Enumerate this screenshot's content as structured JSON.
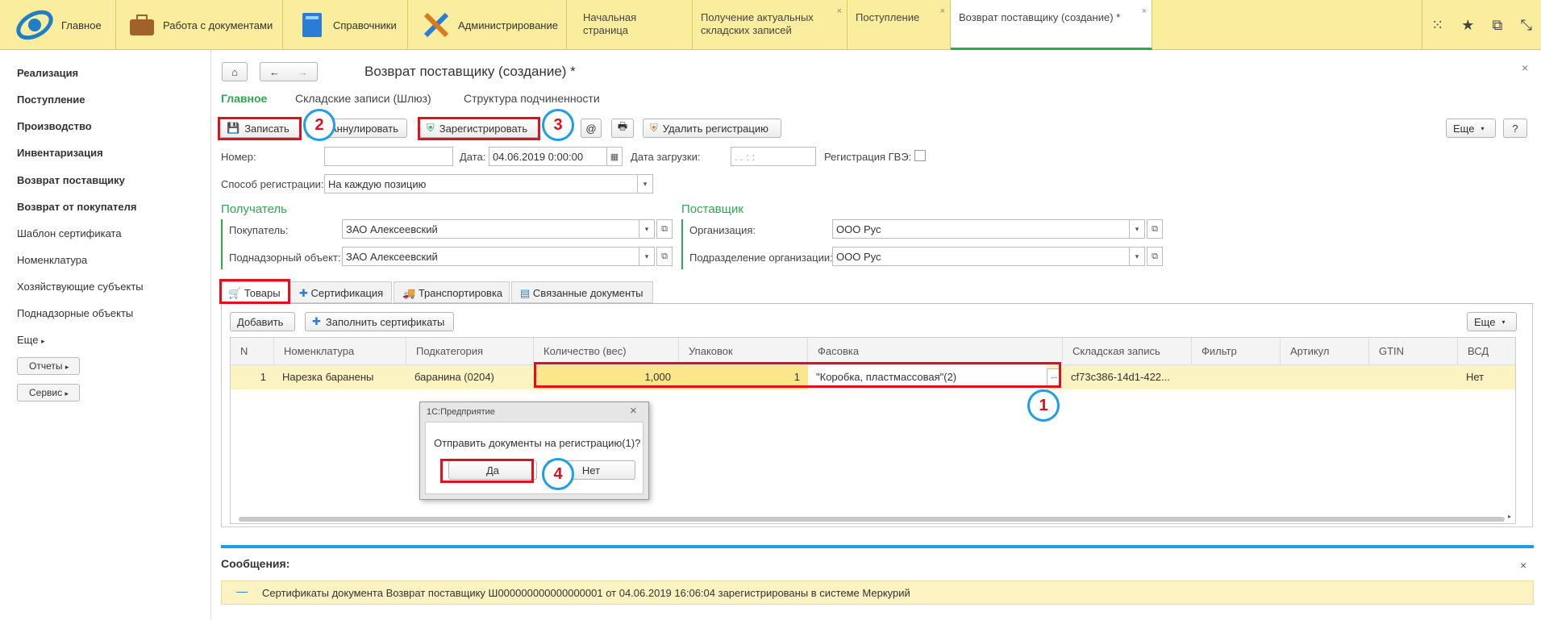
{
  "sections": [
    {
      "label": "Главное",
      "icon": "logo-icon"
    },
    {
      "label": "Работа с документами",
      "icon": "briefcase-icon"
    },
    {
      "label": "Справочники",
      "icon": "book-icon"
    },
    {
      "label": "Администрирование",
      "icon": "tools-icon"
    }
  ],
  "tabs": [
    "Начальная страница",
    "Получение актуальных складских записей",
    "Поступление",
    "Возврат поставщику (создание) *"
  ],
  "close": "×",
  "sidebar": {
    "items": [
      "Реализация",
      "Поступление",
      "Производство",
      "Инвентаризация",
      "Возврат поставщику",
      "Возврат от покупателя",
      "Шаблон сертификата",
      "Номенклатура",
      "Хозяйствующие субъекты",
      "Поднадзорные объекты",
      "Еще"
    ],
    "reports": "Отчеты",
    "service": "Сервис"
  },
  "form": {
    "title": "Возврат поставщику (создание) *",
    "nav": [
      "Главное",
      "Складские записи (Шлюз)",
      "Структура подчиненности"
    ],
    "toolbar": {
      "save": "Записать",
      "cancel": "Аннулировать",
      "register": "Зарегистрировать",
      "at": "@",
      "unregister": "Удалить регистрацию",
      "more": "Еще",
      "help": "?"
    },
    "fields": {
      "number_label": "Номер:",
      "number": "",
      "date_label": "Дата:",
      "date": "04.06.2019  0:00:00",
      "load_label": "Дата загрузки:",
      "load": " .  .       :  :",
      "gve_label": "Регистрация ГВЭ:",
      "method_label": "Способ регистрации:",
      "method": "На каждую позицию"
    },
    "recipient": {
      "title": "Получатель",
      "buyer_label": "Покупатель:",
      "buyer": "ЗАО  Алексеевский",
      "object_label": "Поднадзорный объект:",
      "object": "ЗАО Алексеевский"
    },
    "supplier": {
      "title": "Поставщик",
      "org_label": "Организация:",
      "org": "ООО Рус",
      "div_label": "Подразделение организации:",
      "div": "ООО Рус"
    },
    "subtabs": [
      "Товары",
      "Сертификация",
      "Транспортировка",
      "Связанные документы"
    ],
    "table_toolbar": {
      "add": "Добавить",
      "fill": "Заполнить сертификаты",
      "more": "Еще"
    },
    "table": {
      "columns": [
        "N",
        "Номенклатура",
        "Подкатегория",
        "Количество (вес)",
        "Упаковок",
        "Фасовка",
        "Складская запись",
        "Фильтр",
        "Артикул",
        "GTIN",
        "ВСД"
      ],
      "rows": [
        [
          "1",
          "Нарезка баранены",
          "баранина (0204)",
          "1,000",
          "1",
          "\"Коробка, пластмассовая\"(2)",
          "cf73c386-14d1-422...",
          "",
          "",
          "",
          "Нет"
        ]
      ]
    }
  },
  "dialog": {
    "title": "1С:Предприятие",
    "message": "Отправить документы на регистрацию(1)?",
    "yes": "Да",
    "no": "Нет"
  },
  "messages": {
    "title": "Сообщения:",
    "text": "Сертификаты документа Возврат поставщику Ш000000000000000001 от 04.06.2019 16:06:04 зарегистрированы в системе Меркурий"
  },
  "annotations": [
    "1",
    "2",
    "3",
    "4"
  ],
  "colors": {
    "accent_green": "#2fa84f",
    "header_yellow": "#fbed9e",
    "highlight_red": "#e0101e",
    "marker_blue": "#1e9ee6"
  }
}
